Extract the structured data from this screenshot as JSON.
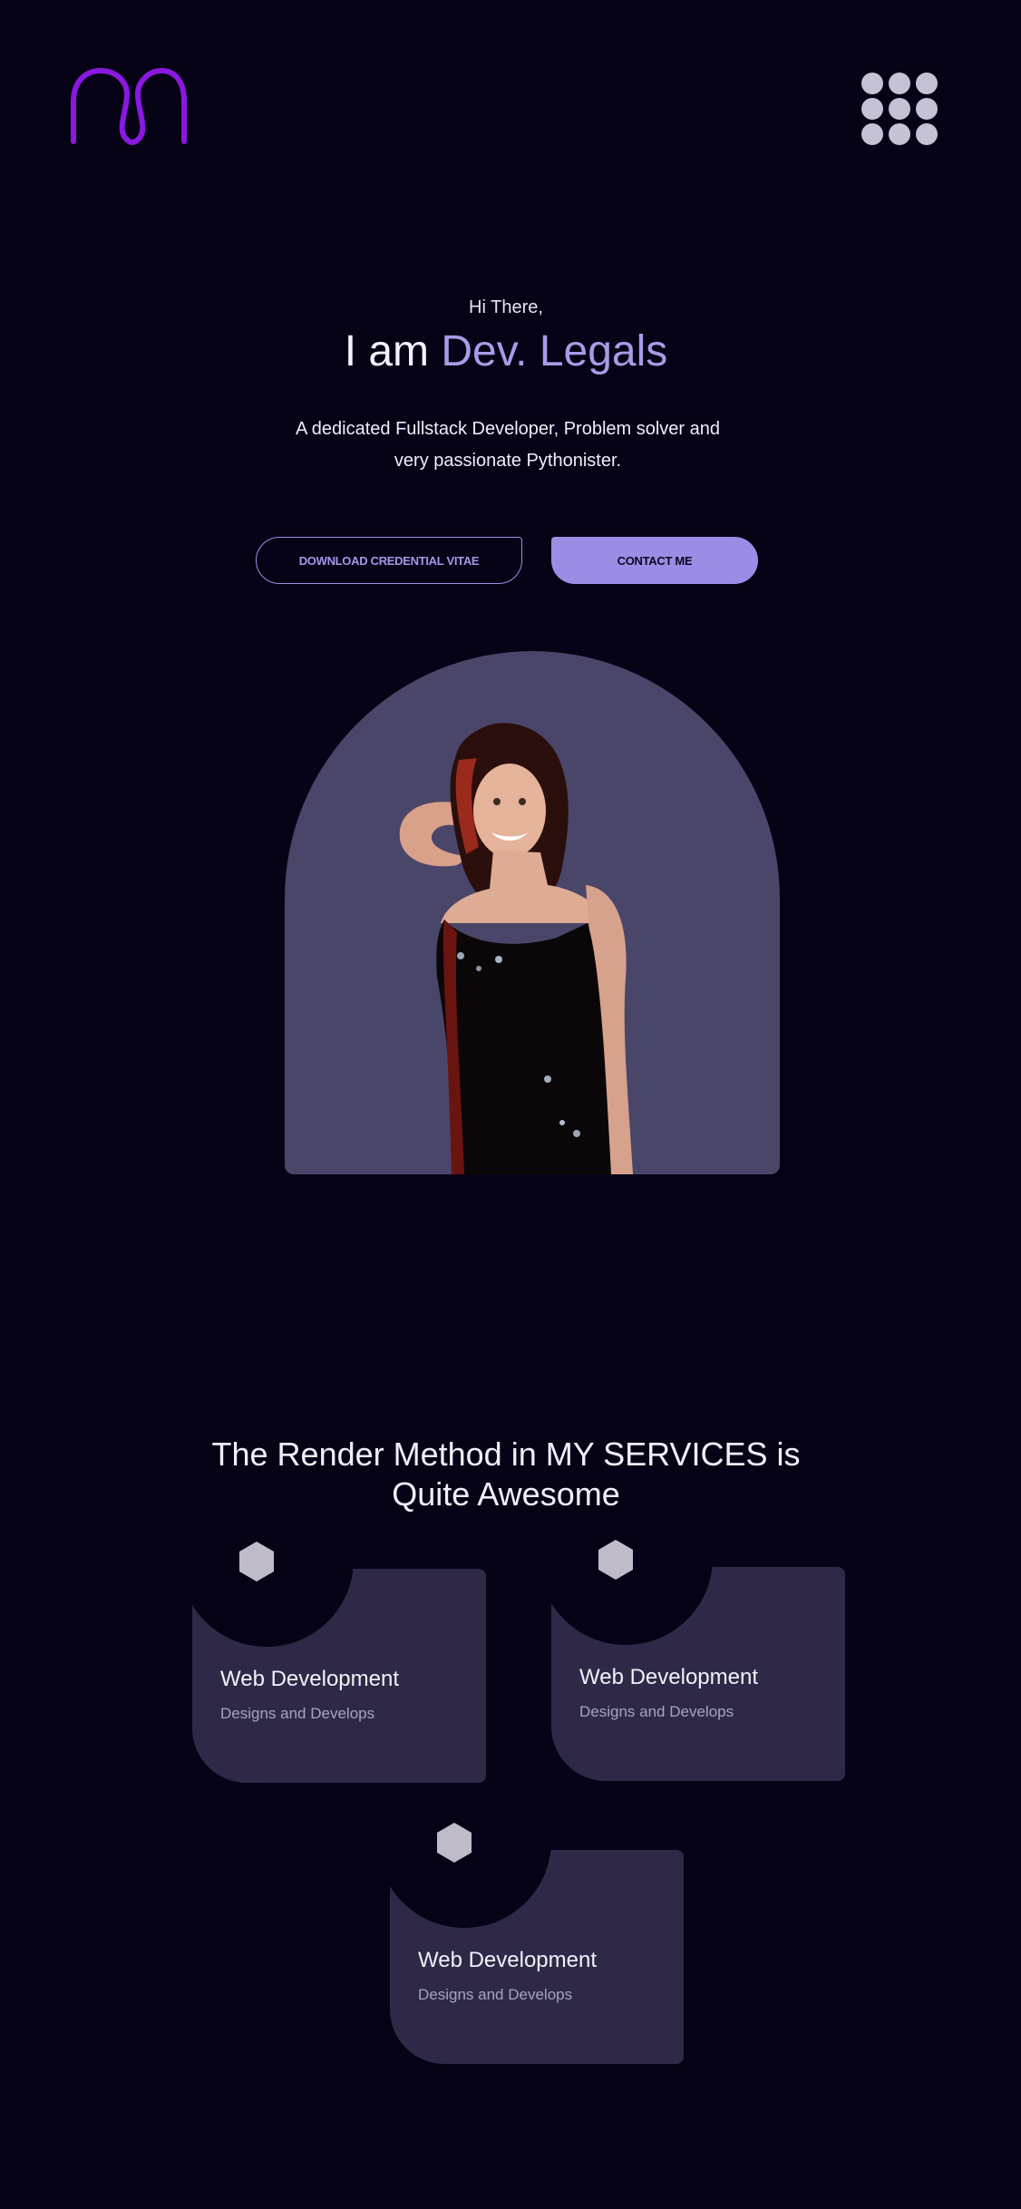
{
  "header": {
    "logo_icon": "m-loop-logo-icon",
    "menu_icon": "dots-grid-menu-icon"
  },
  "hero": {
    "greeting": "Hi There,",
    "title_prefix": "I am ",
    "title_name": "Dev. Legals",
    "description": "A dedicated Fullstack Developer, Problem solver and very passionate Pythonister.",
    "cv_button_label": "DOWNLOAD CREDENTIAL VITAE",
    "contact_button_label": "CONTACT ME",
    "portrait": "portrait-photo"
  },
  "services": {
    "title_line1": "The Render Method in MY SERVICES is",
    "title_line2": "Quite Awesome",
    "cards": [
      {
        "title": "Web Development",
        "subtitle": "Designs and Develops",
        "icon": "hexagon-icon"
      },
      {
        "title": "Web Development",
        "subtitle": "Designs and Develops",
        "icon": "hexagon-icon"
      },
      {
        "title": "Web Development",
        "subtitle": "Designs and Develops",
        "icon": "hexagon-icon"
      }
    ]
  },
  "colors": {
    "background": "#070316",
    "accent": "#9b8de6",
    "logo": "#8a18e0",
    "card": "#2f2947",
    "arch": "#4a4669"
  }
}
